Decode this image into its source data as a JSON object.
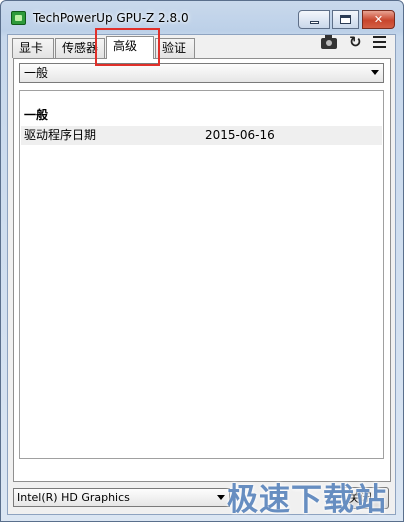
{
  "window": {
    "title": "TechPowerUp GPU-Z 2.8.0",
    "controls": {
      "minimize": "minimize-icon",
      "maximize": "maximize-icon",
      "close_glyph": "✕"
    }
  },
  "tabs": [
    {
      "label": "显卡",
      "active": false
    },
    {
      "label": "传感器",
      "active": false
    },
    {
      "label": "高级",
      "active": true
    },
    {
      "label": "验证",
      "active": false
    }
  ],
  "toolbar": {
    "refresh_glyph": "↻"
  },
  "category_select": {
    "value": "一般"
  },
  "details": {
    "section_title": "一般",
    "rows": [
      {
        "key": "驱动程序日期",
        "value": "2015-06-16"
      }
    ]
  },
  "bottom": {
    "gpu_select_value": "Intel(R) HD Graphics",
    "close_label": "关闭"
  },
  "watermark": "极速下载站",
  "colors": {
    "highlight": "#e0302a",
    "watermark": "#3c6eaf"
  }
}
